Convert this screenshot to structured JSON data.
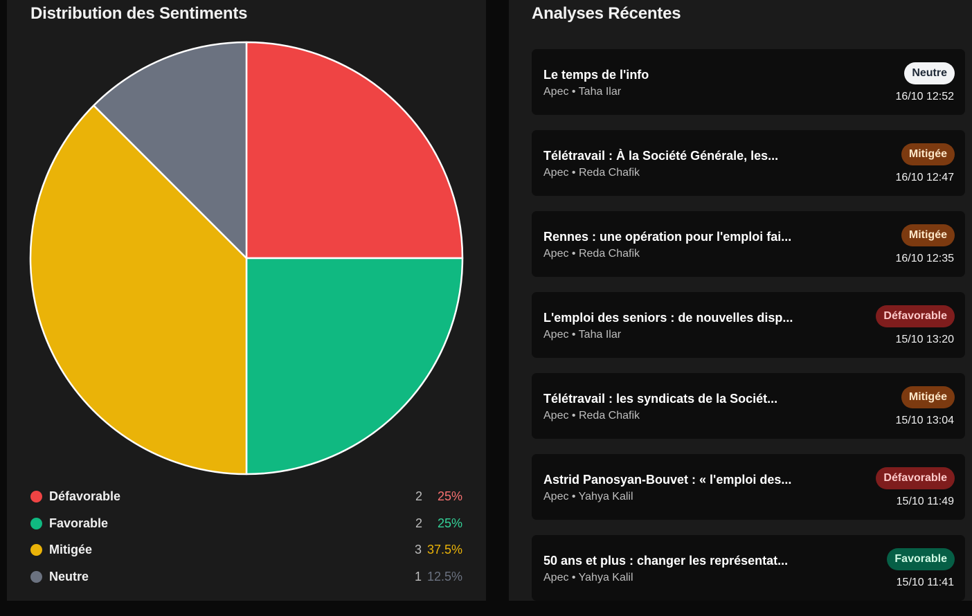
{
  "left": {
    "title": "Distribution des Sentiments"
  },
  "colors": {
    "defavorable": "#ef4444",
    "favorable": "#10b981",
    "mitigee": "#eab308",
    "neutre": "#6b7280"
  },
  "chart_data": {
    "type": "pie",
    "categories": [
      "Défavorable",
      "Favorable",
      "Mitigée",
      "Neutre"
    ],
    "values": [
      2,
      2,
      3,
      1
    ],
    "percentages": [
      "25%",
      "25%",
      "37.5%",
      "12.5%"
    ],
    "colors": [
      "#ef4444",
      "#10b981",
      "#eab308",
      "#6b7280"
    ],
    "title": "Distribution des Sentiments"
  },
  "legend": [
    {
      "label": "Défavorable",
      "count": "2",
      "pct": "25%",
      "dot": "#ef4444",
      "pct_color": "#f87171"
    },
    {
      "label": "Favorable",
      "count": "2",
      "pct": "25%",
      "dot": "#10b981",
      "pct_color": "#34d399"
    },
    {
      "label": "Mitigée",
      "count": "3",
      "pct": "37.5%",
      "dot": "#eab308",
      "pct_color": "#eab308"
    },
    {
      "label": "Neutre",
      "count": "1",
      "pct": "12.5%",
      "dot": "#6b7280",
      "pct_color": "#6b7280"
    }
  ],
  "right": {
    "title": "Analyses Récentes"
  },
  "badge_styles": {
    "Neutre": {
      "bg": "#f3f4f6",
      "fg": "#1f2937"
    },
    "Mitigée": {
      "bg": "#7c3a10",
      "fg": "#fde7c8"
    },
    "Défavorable": {
      "bg": "#7f1d1d",
      "fg": "#fecaca"
    },
    "Favorable": {
      "bg": "#065f46",
      "fg": "#d1fae5"
    }
  },
  "analyses": [
    {
      "title": "Le temps de l'info",
      "meta": "Apec • Taha Ilar",
      "sentiment": "Neutre",
      "time": "16/10 12:52"
    },
    {
      "title": "Télétravail : À la Société Générale, les...",
      "meta": "Apec • Reda Chafik",
      "sentiment": "Mitigée",
      "time": "16/10 12:47"
    },
    {
      "title": "Rennes : une opération pour l'emploi fai...",
      "meta": "Apec • Reda Chafik",
      "sentiment": "Mitigée",
      "time": "16/10 12:35"
    },
    {
      "title": "L'emploi des seniors : de nouvelles disp...",
      "meta": "Apec • Taha Ilar",
      "sentiment": "Défavorable",
      "time": "15/10 13:20"
    },
    {
      "title": "Télétravail : les syndicats de la Sociét...",
      "meta": "Apec • Reda Chafik",
      "sentiment": "Mitigée",
      "time": "15/10 13:04"
    },
    {
      "title": "Astrid Panosyan-Bouvet : « l'emploi des...",
      "meta": "Apec • Yahya Kalil",
      "sentiment": "Défavorable",
      "time": "15/10 11:49"
    },
    {
      "title": "50 ans et plus : changer les représentat...",
      "meta": "Apec • Yahya Kalil",
      "sentiment": "Favorable",
      "time": "15/10 11:41"
    }
  ]
}
